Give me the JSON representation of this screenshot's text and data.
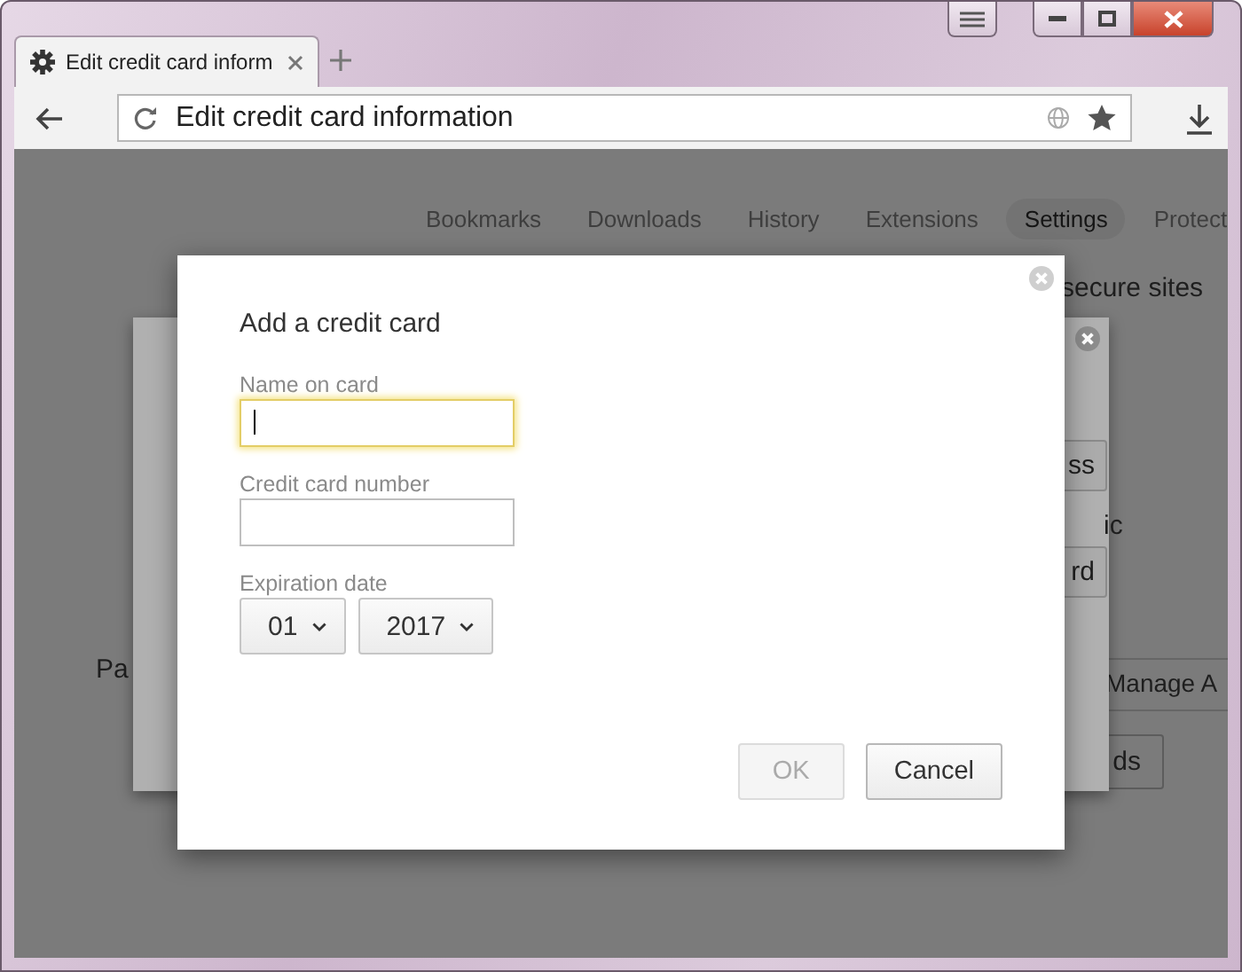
{
  "tab": {
    "title": "Edit credit card inform"
  },
  "address_bar": {
    "value": "Edit credit card information"
  },
  "settings_nav": [
    {
      "label": "Bookmarks",
      "selected": false
    },
    {
      "label": "Downloads",
      "selected": false
    },
    {
      "label": "History",
      "selected": false
    },
    {
      "label": "Extensions",
      "selected": false
    },
    {
      "label": "Settings",
      "selected": true
    },
    {
      "label": "Protect",
      "selected": false
    }
  ],
  "background": {
    "secure_text": "secure sites",
    "left_text": "Pa",
    "side_text": "ic",
    "buttons": [
      "ss",
      "rd"
    ],
    "manage_button": "Manage A",
    "ds_button": "ds"
  },
  "dialog": {
    "title": "Add a credit card",
    "fields": [
      {
        "label": "Name on card",
        "focused": true
      },
      {
        "label": "Credit card number",
        "focused": false
      }
    ],
    "expiration": {
      "label": "Expiration date",
      "month": "01",
      "year": "2017"
    },
    "buttons": [
      {
        "label": "OK",
        "disabled": true
      },
      {
        "label": "Cancel",
        "disabled": false
      }
    ]
  }
}
